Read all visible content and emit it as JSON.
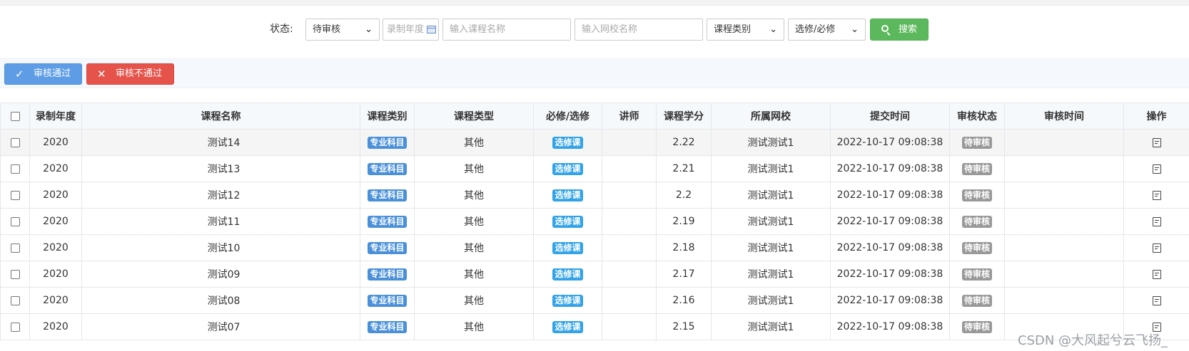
{
  "filter": {
    "status_label": "状态:",
    "status_value": "待审核",
    "year_placeholder": "录制年度",
    "course_placeholder": "输入课程名称",
    "school_placeholder": "输入网校名称",
    "category_value": "课程类别",
    "required_value": "选修/必修",
    "search_label": "搜索"
  },
  "actions": {
    "approve_label": "审核通过",
    "reject_label": "审核不通过"
  },
  "table": {
    "headers": [
      "录制年度",
      "课程名称",
      "课程类别",
      "课程类型",
      "必修/选修",
      "讲师",
      "课程学分",
      "所属网校",
      "提交时间",
      "审核状态",
      "审核时间",
      "操作"
    ],
    "rows": [
      {
        "year": "2020",
        "name": "测试14",
        "category": "专业科目",
        "type": "其他",
        "required": "选修课",
        "teacher": "",
        "credit": "2.22",
        "school": "测试测试1",
        "submit_time": "2022-10-17 09:08:38",
        "status": "待审核",
        "review_time": ""
      },
      {
        "year": "2020",
        "name": "测试13",
        "category": "专业科目",
        "type": "其他",
        "required": "选修课",
        "teacher": "",
        "credit": "2.21",
        "school": "测试测试1",
        "submit_time": "2022-10-17 09:08:38",
        "status": "待审核",
        "review_time": ""
      },
      {
        "year": "2020",
        "name": "测试12",
        "category": "专业科目",
        "type": "其他",
        "required": "选修课",
        "teacher": "",
        "credit": "2.2",
        "school": "测试测试1",
        "submit_time": "2022-10-17 09:08:38",
        "status": "待审核",
        "review_time": ""
      },
      {
        "year": "2020",
        "name": "测试11",
        "category": "专业科目",
        "type": "其他",
        "required": "选修课",
        "teacher": "",
        "credit": "2.19",
        "school": "测试测试1",
        "submit_time": "2022-10-17 09:08:38",
        "status": "待审核",
        "review_time": ""
      },
      {
        "year": "2020",
        "name": "测试10",
        "category": "专业科目",
        "type": "其他",
        "required": "选修课",
        "teacher": "",
        "credit": "2.18",
        "school": "测试测试1",
        "submit_time": "2022-10-17 09:08:38",
        "status": "待审核",
        "review_time": ""
      },
      {
        "year": "2020",
        "name": "测试09",
        "category": "专业科目",
        "type": "其他",
        "required": "选修课",
        "teacher": "",
        "credit": "2.17",
        "school": "测试测试1",
        "submit_time": "2022-10-17 09:08:38",
        "status": "待审核",
        "review_time": ""
      },
      {
        "year": "2020",
        "name": "测试08",
        "category": "专业科目",
        "type": "其他",
        "required": "选修课",
        "teacher": "",
        "credit": "2.16",
        "school": "测试测试1",
        "submit_time": "2022-10-17 09:08:38",
        "status": "待审核",
        "review_time": ""
      },
      {
        "year": "2020",
        "name": "测试07",
        "category": "专业科目",
        "type": "其他",
        "required": "选修课",
        "teacher": "",
        "credit": "2.15",
        "school": "测试测试1",
        "submit_time": "2022-10-17 09:08:38",
        "status": "待审核",
        "review_time": ""
      }
    ]
  },
  "watermark": "CSDN @大风起兮云飞扬_",
  "colors": {
    "search_button": "#5cb85c",
    "approve_button": "#5e9de6",
    "reject_button": "#e5534b",
    "category_tag": "#4a90d9",
    "required_tag": "#32a3e8",
    "status_tag": "#999999"
  },
  "icons": {
    "search": "magnifier-icon",
    "approve": "check-icon",
    "reject": "close-icon",
    "operate": "edit-icon",
    "year_picker": "calendar-icon"
  }
}
